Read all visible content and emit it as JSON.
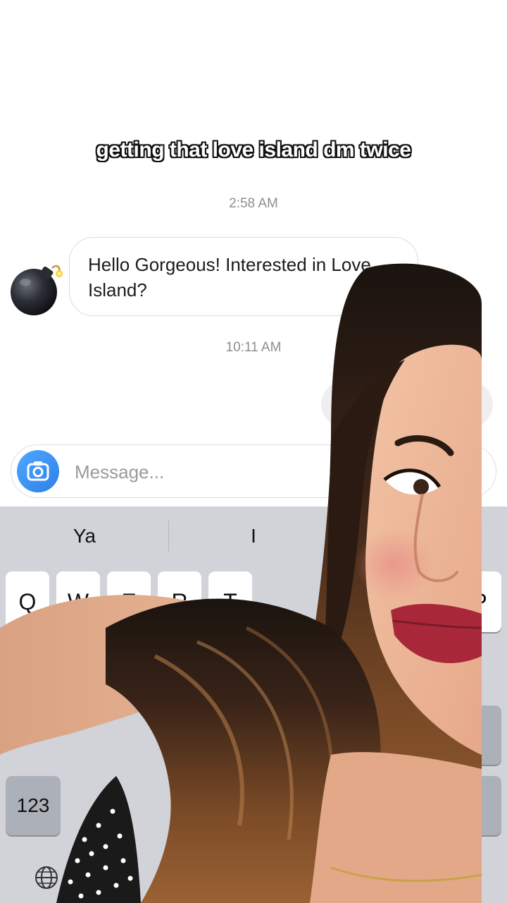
{
  "caption": "getting that love island dm twice",
  "thread": {
    "timestamp_1": "2:58 AM",
    "avatar": "bomb-emoji",
    "message_1": "Hello Gorgeous! Interested in Love Island?",
    "timestamp_2": "10:11 AM"
  },
  "composer": {
    "placeholder": "Message...",
    "camera_icon": "camera-icon"
  },
  "keyboard": {
    "suggestions": [
      "Ya",
      "I"
    ],
    "row1_visible": [
      "Q",
      "W",
      "E",
      "R",
      "T",
      "P"
    ],
    "numbers_key": "123",
    "globe_icon": "globe-icon"
  },
  "colors": {
    "background": "#ffffff",
    "bubble_border": "#dcdcdc",
    "keyboard_bg": "#d1d3d9",
    "camera_blue": "#3a8ef0",
    "timestamp": "#8e8e93"
  }
}
